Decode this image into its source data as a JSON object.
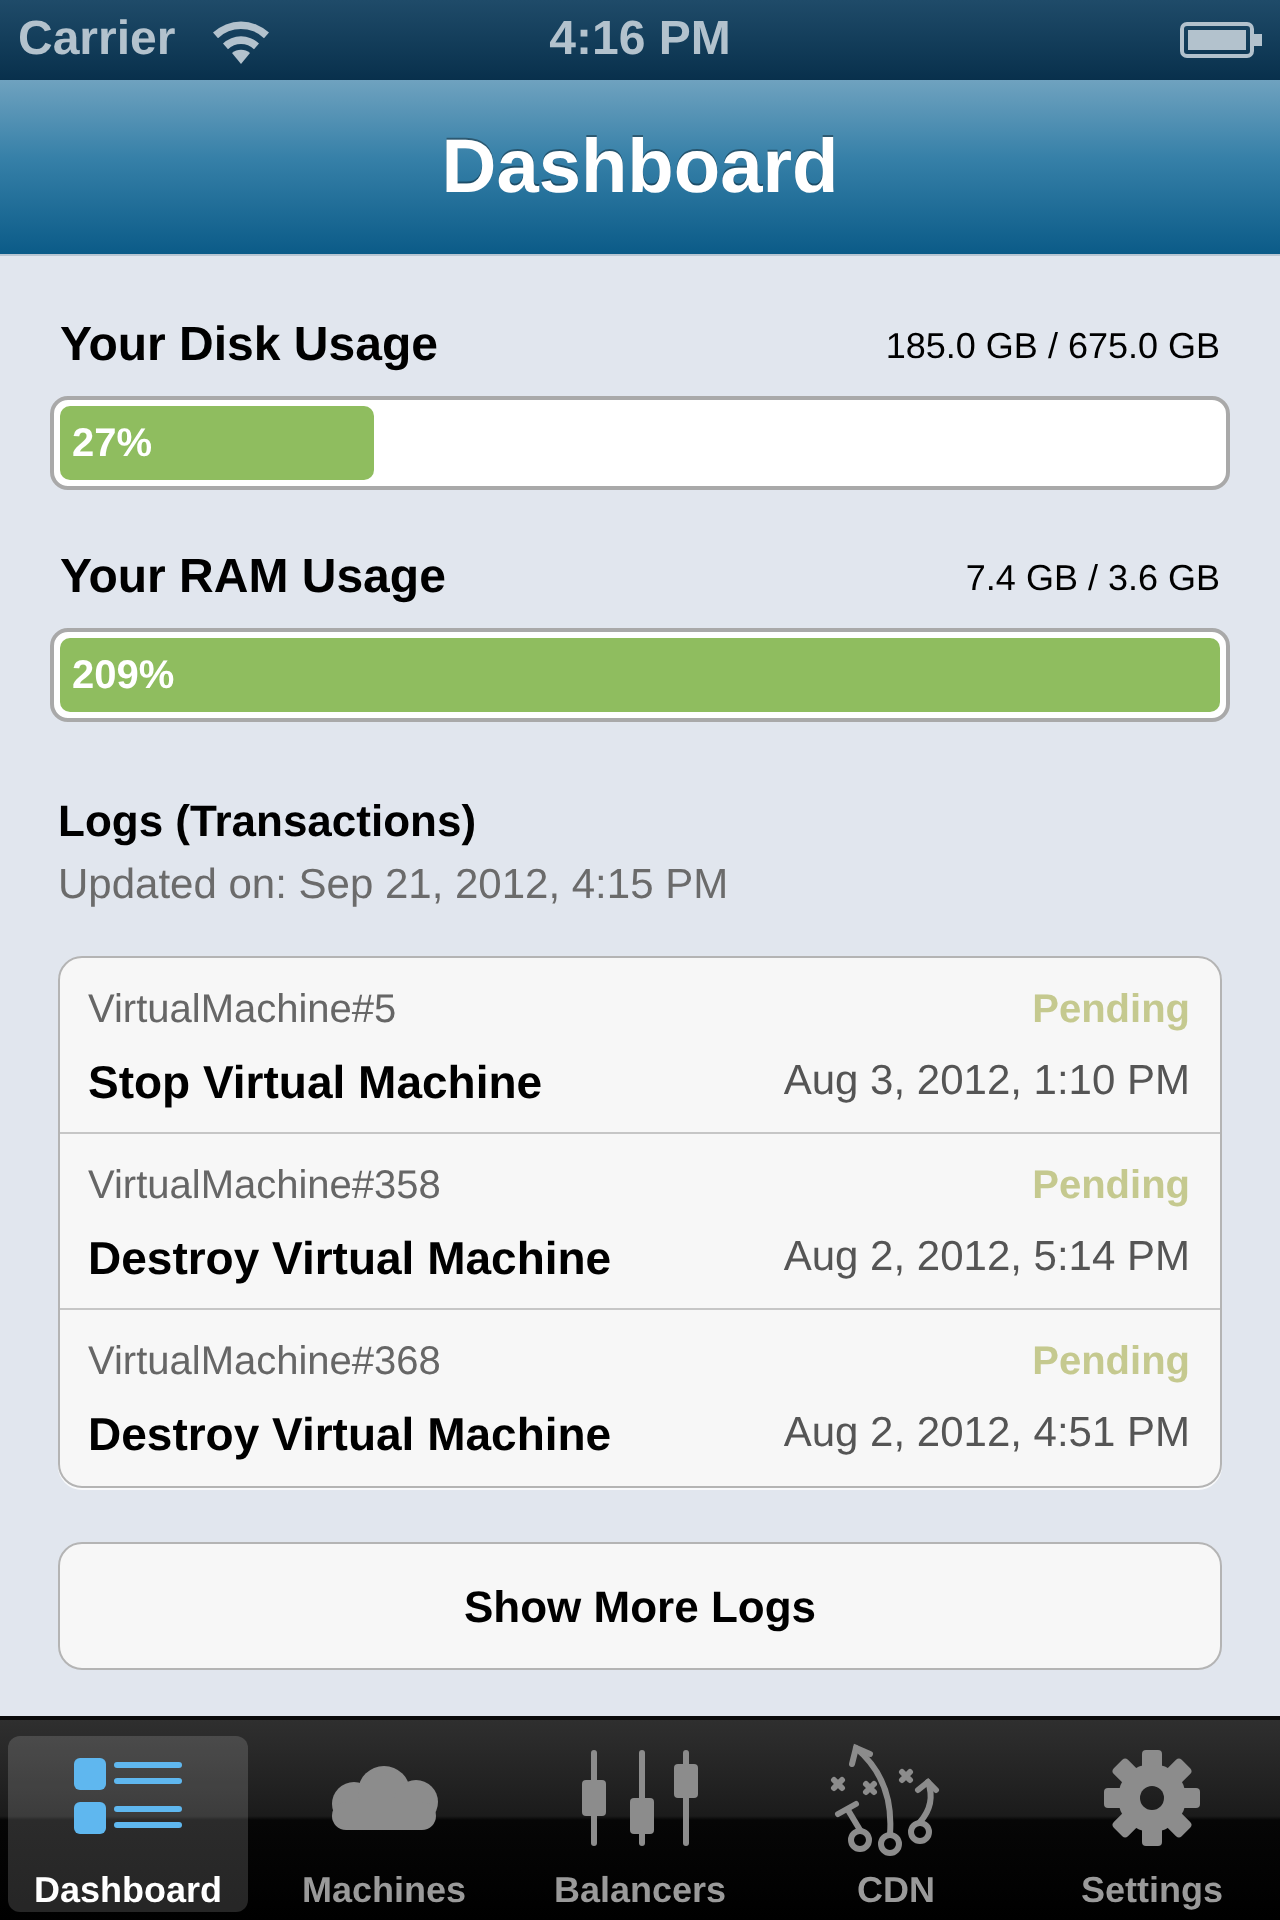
{
  "status_bar": {
    "carrier": "Carrier",
    "time": "4:16 PM"
  },
  "nav_bar": {
    "title": "Dashboard"
  },
  "usage": [
    {
      "label": "Your Disk Usage",
      "amount": "185.0 GB / 675.0 GB",
      "level": 0.27,
      "percent": "27%"
    },
    {
      "label": "Your RAM Usage",
      "amount": "7.4 GB / 3.6 GB",
      "level": 1,
      "percent": "209%"
    }
  ],
  "logs": {
    "title": "Logs (Transactions)",
    "updated": "Updated on: Sep 21, 2012, 4:15 PM",
    "entries": [
      {
        "machine": "VirtualMachine#5",
        "status": "Pending",
        "action": "Stop Virtual Machine",
        "date": "Aug 3, 2012, 1:10 PM"
      },
      {
        "machine": "VirtualMachine#358",
        "status": "Pending",
        "action": "Destroy Virtual Machine",
        "date": "Aug 2, 2012, 5:14 PM"
      },
      {
        "machine": "VirtualMachine#368",
        "status": "Pending",
        "action": "Destroy Virtual Machine",
        "date": "Aug 2, 2012, 4:51 PM"
      }
    ]
  },
  "show_more_button": "Show More Logs",
  "tabs": [
    {
      "label": "Dashboard",
      "selected": true
    },
    {
      "label": "Machines",
      "selected": false
    },
    {
      "label": "Balancers",
      "selected": false
    },
    {
      "label": "CDN",
      "selected": false
    },
    {
      "label": "Settings",
      "selected": false
    }
  ]
}
